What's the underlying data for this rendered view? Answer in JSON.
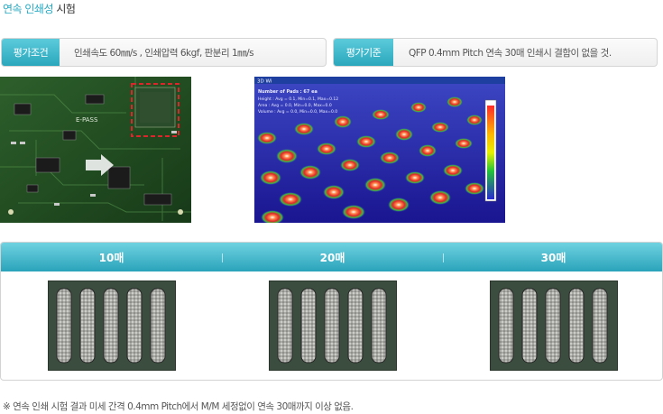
{
  "title": {
    "highlight": "연속 인쇄성",
    "rest": " 시험"
  },
  "conditions": {
    "label": "평가조건",
    "value": "인쇄속도 60㎜/s , 인쇄압력 6kgf, 판분리 1㎜/s"
  },
  "criteria": {
    "label": "평가기준",
    "value": "QFP 0.4mm Pitch 연속 30매 인쇄시 결함이 없을 것."
  },
  "pcb_image": {
    "board_label": "E-PASS"
  },
  "heatmap_image": {
    "window_title": "3D Wi",
    "header": "Number of Pads : 67 ea",
    "lines": [
      "Height : Avg = 0.1, Min=0.1, Max=0.12",
      "Area : Avg = 0.0, Min=0.0, Max=0.0",
      "Volume : Avg = 0.0, Min=0.0, Max=0.0"
    ]
  },
  "results": {
    "columns": [
      "10매",
      "20매",
      "30매"
    ]
  },
  "footnote": "※ 연속 인쇄 시험 결과 미세 간격 0.4mm Pitch에서  M/M 세정없이 연속 30매까지 이상 없음.",
  "colors": {
    "accent": "#2aa7bd",
    "title_highlight": "#25a9c2"
  }
}
